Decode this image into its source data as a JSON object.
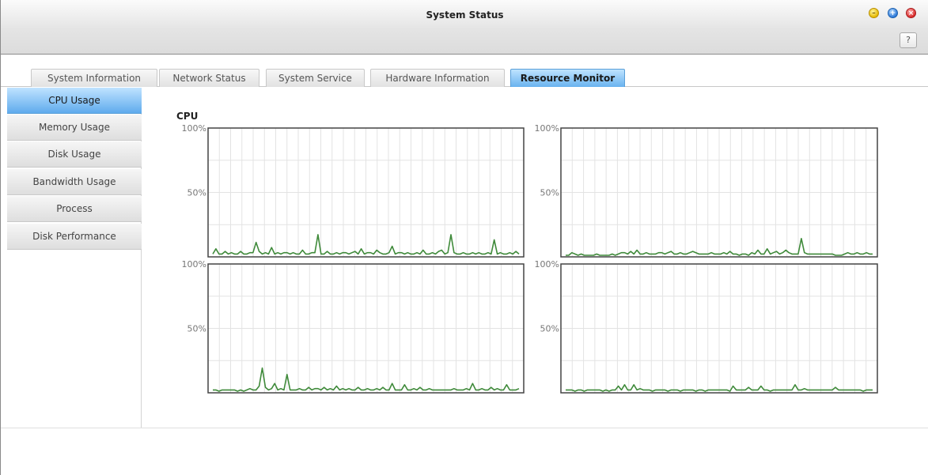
{
  "window": {
    "title": "System Status",
    "help_label": "?",
    "controls": {
      "minimize": "minimize-icon",
      "maximize": "maximize-icon",
      "close": "close-icon"
    }
  },
  "tabs": [
    {
      "label": "System Information",
      "active": false
    },
    {
      "label": "Network Status",
      "active": false
    },
    {
      "label": "System Service",
      "active": false
    },
    {
      "label": "Hardware Information",
      "active": false
    },
    {
      "label": "Resource Monitor",
      "active": true
    }
  ],
  "sidebar": {
    "items": [
      {
        "label": "CPU Usage",
        "active": true
      },
      {
        "label": "Memory Usage",
        "active": false
      },
      {
        "label": "Disk Usage",
        "active": false
      },
      {
        "label": "Bandwidth Usage",
        "active": false
      },
      {
        "label": "Process",
        "active": false
      },
      {
        "label": "Disk Performance",
        "active": false
      }
    ]
  },
  "main": {
    "section_title": "CPU"
  },
  "colors": {
    "accent": "#5fabed",
    "line": "#3f8a3a",
    "grid": "#e3e3e3",
    "axis": "#444444"
  },
  "chart_data": [
    {
      "type": "line",
      "ylabels": [
        "100%",
        "50%"
      ],
      "ylim": [
        0,
        100
      ],
      "grid": true,
      "values": [
        1,
        5,
        1,
        1,
        3,
        1,
        2,
        1,
        1,
        3,
        1,
        1,
        2,
        2,
        10,
        3,
        1,
        2,
        1,
        6,
        1,
        2,
        1,
        2,
        2,
        1,
        2,
        1,
        1,
        4,
        1,
        1,
        2,
        2,
        16,
        1,
        1,
        3,
        1,
        1,
        2,
        1,
        2,
        2,
        1,
        2,
        3,
        1,
        5,
        1,
        2,
        2,
        1,
        4,
        2,
        1,
        1,
        2,
        7,
        1,
        2,
        2,
        1,
        2,
        1,
        1,
        2,
        1,
        4,
        1,
        1,
        2,
        1,
        3,
        4,
        1,
        2,
        16,
        2,
        1,
        1,
        2,
        1,
        1,
        2,
        1,
        2,
        1,
        1,
        2,
        1,
        12,
        1,
        2,
        1,
        1,
        2,
        1,
        3,
        1
      ]
    },
    {
      "type": "line",
      "ylabels": [
        "100%",
        "50%"
      ],
      "ylim": [
        0,
        100
      ],
      "grid": true,
      "values": [
        0,
        0,
        2,
        1,
        0,
        1,
        0,
        0,
        0,
        0,
        1,
        0,
        0,
        0,
        0,
        1,
        0,
        1,
        2,
        2,
        1,
        3,
        1,
        4,
        1,
        1,
        2,
        1,
        1,
        1,
        2,
        2,
        1,
        2,
        3,
        1,
        1,
        2,
        1,
        1,
        2,
        3,
        2,
        1,
        1,
        1,
        1,
        2,
        1,
        1,
        1,
        2,
        1,
        3,
        1,
        1,
        0,
        1,
        1,
        0,
        2,
        1,
        4,
        1,
        1,
        5,
        1,
        2,
        3,
        1,
        2,
        4,
        2,
        1,
        1,
        1,
        13,
        2,
        1,
        1,
        1,
        1,
        1,
        1,
        1,
        1,
        1,
        0,
        0,
        0,
        1,
        2,
        1,
        1,
        2,
        1,
        1,
        2,
        1,
        1
      ]
    },
    {
      "type": "line",
      "ylabels": [
        "100%",
        "50%"
      ],
      "ylim": [
        0,
        100
      ],
      "grid": true,
      "values": [
        1,
        1,
        0,
        1,
        1,
        1,
        1,
        1,
        0,
        1,
        0,
        1,
        2,
        1,
        1,
        4,
        18,
        3,
        1,
        2,
        6,
        1,
        2,
        1,
        13,
        1,
        1,
        1,
        2,
        1,
        1,
        3,
        1,
        2,
        2,
        1,
        3,
        1,
        2,
        1,
        4,
        1,
        2,
        1,
        2,
        1,
        1,
        3,
        1,
        1,
        2,
        1,
        1,
        2,
        1,
        3,
        1,
        1,
        6,
        1,
        1,
        1,
        5,
        1,
        1,
        2,
        1,
        3,
        1,
        1,
        2,
        1,
        1,
        1,
        1,
        1,
        1,
        1,
        2,
        1,
        1,
        1,
        2,
        1,
        6,
        1,
        1,
        2,
        1,
        1,
        3,
        1,
        2,
        1,
        1,
        5,
        1,
        1,
        1,
        2
      ]
    },
    {
      "type": "line",
      "ylabels": [
        "100%",
        "50%"
      ],
      "ylim": [
        0,
        100
      ],
      "grid": true,
      "values": [
        1,
        1,
        1,
        0,
        1,
        1,
        0,
        1,
        1,
        1,
        1,
        1,
        0,
        1,
        0,
        1,
        1,
        4,
        1,
        5,
        1,
        1,
        5,
        1,
        2,
        1,
        1,
        1,
        0,
        1,
        1,
        1,
        1,
        0,
        1,
        1,
        1,
        0,
        1,
        1,
        1,
        1,
        0,
        1,
        1,
        0,
        1,
        1,
        1,
        1,
        1,
        1,
        1,
        0,
        4,
        1,
        1,
        1,
        1,
        3,
        1,
        1,
        1,
        4,
        1,
        1,
        0,
        1,
        1,
        1,
        1,
        1,
        1,
        1,
        5,
        1,
        1,
        2,
        1,
        1,
        1,
        1,
        1,
        1,
        1,
        1,
        1,
        3,
        1,
        1,
        1,
        1,
        1,
        1,
        1,
        1,
        0,
        1,
        1,
        1
      ]
    }
  ]
}
